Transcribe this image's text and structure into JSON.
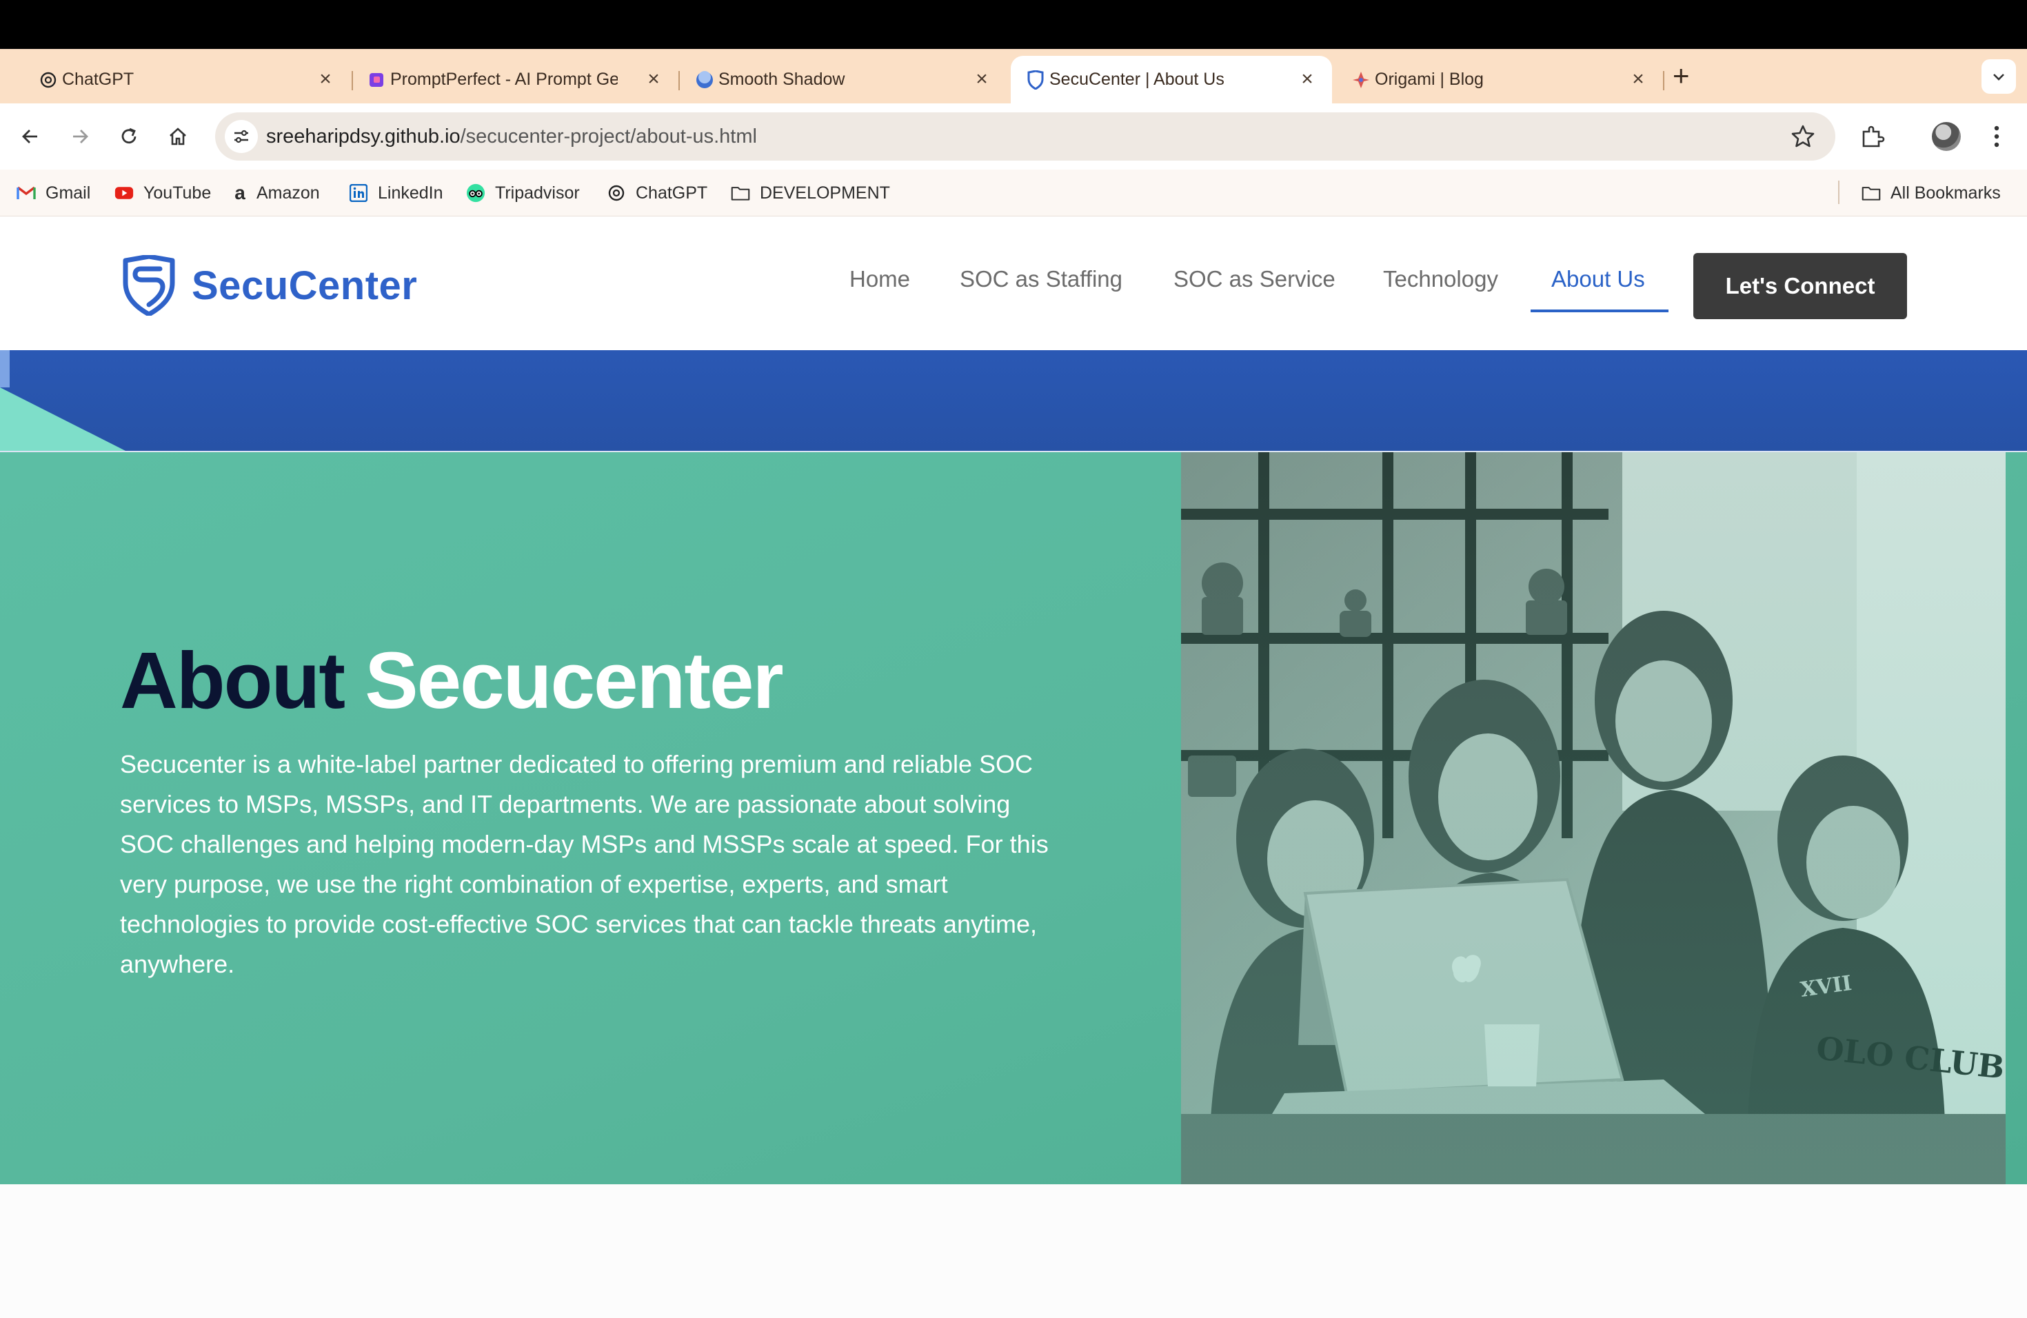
{
  "browser": {
    "tabs": [
      {
        "title": "ChatGPT",
        "icon": "chatgpt-icon",
        "active": false
      },
      {
        "title": "PromptPerfect - AI Prompt Generator",
        "icon": "promptperfect-icon",
        "active": false
      },
      {
        "title": "Smooth Shadow",
        "icon": "smooth-shadow-icon",
        "active": false
      },
      {
        "title": "SecuCenter | About Us",
        "icon": "secucenter-shield-icon",
        "active": true
      },
      {
        "title": "Origami | Blog",
        "icon": "origami-icon",
        "active": false
      }
    ],
    "address": {
      "host": "sreeharipdsy.github.io",
      "path": "/secucenter-project/about-us.html"
    },
    "bookmarks": [
      {
        "label": "Gmail",
        "icon": "gmail-icon"
      },
      {
        "label": "YouTube",
        "icon": "youtube-icon"
      },
      {
        "label": "Amazon",
        "icon": "amazon-icon"
      },
      {
        "label": "LinkedIn",
        "icon": "linkedin-icon"
      },
      {
        "label": "Tripadvisor",
        "icon": "tripadvisor-icon"
      },
      {
        "label": "ChatGPT",
        "icon": "chatgpt-icon"
      },
      {
        "label": "DEVELOPMENT",
        "icon": "folder-icon"
      }
    ],
    "all_bookmarks_label": "All Bookmarks"
  },
  "site": {
    "brand": "SecuCenter",
    "nav": [
      {
        "label": "Home",
        "active": false
      },
      {
        "label": "SOC as Staffing",
        "active": false
      },
      {
        "label": "SOC as Service",
        "active": false
      },
      {
        "label": "Technology",
        "active": false
      },
      {
        "label": "About Us",
        "active": true
      }
    ],
    "cta_label": "Let's Connect",
    "hero": {
      "title_dark": "About",
      "title_light": "Secucenter",
      "body": "Secucenter is a white-label partner dedicated to offering premium and reliable SOC services to MSPs, MSSPs, and IT departments. We are passionate about solving SOC challenges and helping modern-day MSPs and MSSPs scale at speed. For this very purpose, we use the right combination of expertise, experts, and smart technologies to provide cost-effective SOC services that can tackle threats anytime, anywhere."
    }
  },
  "colors": {
    "brand_blue": "#2f62c9",
    "band_blue": "#2a58b4",
    "hero_teal": "#58b79c",
    "title_navy": "#0b1432",
    "cta_dark": "#3b3b3b",
    "tab_strip": "#fbe0c6"
  }
}
